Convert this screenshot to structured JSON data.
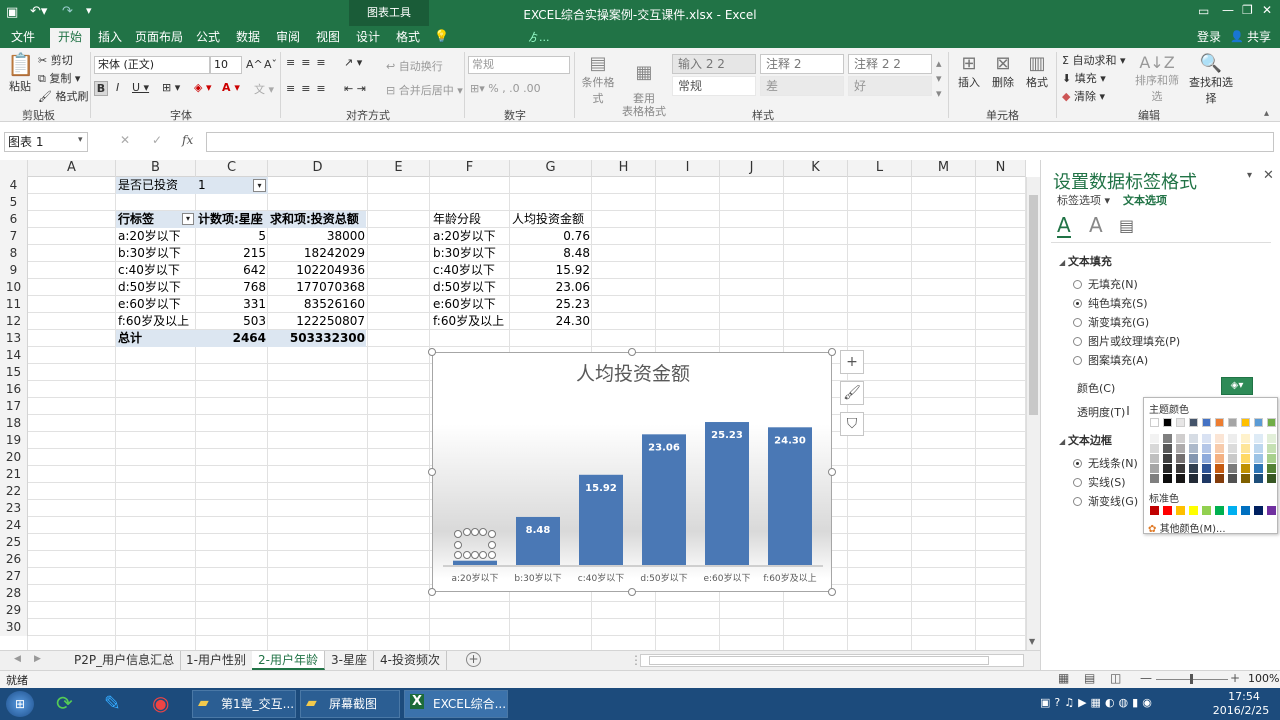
{
  "window": {
    "title": "EXCEL综合实操案例-交互课件.xlsx - Excel",
    "tools_title": "图表工具",
    "signin": "登录",
    "share": "共享"
  },
  "tabs": [
    "文件",
    "开始",
    "插入",
    "页面布局",
    "公式",
    "数据",
    "审阅",
    "视图",
    "设计",
    "格式"
  ],
  "ribbon": {
    "clipboard": {
      "paste": "粘贴",
      "cut": "剪切",
      "copy": "复制",
      "format_painter": "格式刷",
      "label": "剪贴板"
    },
    "font": {
      "name": "宋体 (正文)",
      "size": "10",
      "label": "字体"
    },
    "alignment": {
      "wrap": "自动换行",
      "merge": "合并后居中",
      "label": "对齐方式"
    },
    "number": {
      "format": "常规",
      "label": "数字"
    },
    "styles": {
      "conditional": "条件格式",
      "table": "套用\n表格格式",
      "cells": [
        "输入 2 2",
        "注释 2",
        "注释 2 2",
        "常规",
        "差",
        "好"
      ],
      "label": "样式"
    },
    "cells": {
      "insert": "插入",
      "delete": "删除",
      "format": "格式",
      "label": "单元格"
    },
    "editing": {
      "autosum": "自动求和",
      "fill": "填充",
      "clear": "清除",
      "sort": "排序和筛选",
      "find": "查找和选择",
      "label": "编辑"
    }
  },
  "formula": {
    "namebox": "图表 1",
    "fx": "fx",
    "value": ""
  },
  "columns": [
    "A",
    "B",
    "C",
    "D",
    "E",
    "F",
    "G",
    "H",
    "I",
    "J",
    "K",
    "L",
    "M",
    "N"
  ],
  "rows": [
    "4",
    "5",
    "6",
    "7",
    "8",
    "9",
    "10",
    "11",
    "12",
    "13",
    "14",
    "15",
    "16",
    "17",
    "18",
    "19",
    "20",
    "21",
    "22",
    "23",
    "24",
    "25",
    "26",
    "27",
    "28",
    "29",
    "30"
  ],
  "filter": {
    "label": "是否已投资",
    "value": "1"
  },
  "pivot": {
    "headers": [
      "行标签",
      "计数项:星座",
      "求和项:投资总额"
    ],
    "rows": [
      [
        "a:20岁以下",
        "5",
        "38000"
      ],
      [
        "b:30岁以下",
        "215",
        "18242029"
      ],
      [
        "c:40岁以下",
        "642",
        "102204936"
      ],
      [
        "d:50岁以下",
        "768",
        "177070368"
      ],
      [
        "e:60岁以下",
        "331",
        "83526160"
      ],
      [
        "f:60岁及以上",
        "503",
        "122250807"
      ]
    ],
    "total": [
      "总计",
      "2464",
      "503332300"
    ]
  },
  "table2": {
    "headers": [
      "年龄分段",
      "人均投资金额"
    ],
    "rows": [
      [
        "a:20岁以下",
        "0.76"
      ],
      [
        "b:30岁以下",
        "8.48"
      ],
      [
        "c:40岁以下",
        "15.92"
      ],
      [
        "d:50岁以下",
        "23.06"
      ],
      [
        "e:60岁以下",
        "25.23"
      ],
      [
        "f:60岁及以上",
        "24.30"
      ]
    ]
  },
  "chart_data": {
    "type": "bar",
    "title": "人均投资金额",
    "categories": [
      "a:20岁以下",
      "b:30岁以下",
      "c:40岁以下",
      "d:50岁以下",
      "e:60岁以下",
      "f:60岁及以上"
    ],
    "values": [
      0.76,
      8.48,
      15.92,
      23.06,
      25.23,
      24.3
    ],
    "labels": [
      "",
      "8.48",
      "15.92",
      "23.06",
      "25.23",
      "24.30"
    ],
    "ylim": [
      0,
      30
    ],
    "bar_color": "#4a78b5",
    "legend": "none",
    "grid": false
  },
  "chart_buttons": [
    "+",
    "brush",
    "filter"
  ],
  "sheets": [
    "P2P_用户信息汇总",
    "1-用户性别",
    "2-用户年龄",
    "3-星座",
    "4-投资频次"
  ],
  "status": {
    "ready": "就绪",
    "zoom": "100%"
  },
  "pane": {
    "title": "设置数据标签格式",
    "tab_label_options": "标签选项",
    "tab_text_options": "文本选项",
    "fill_section": "文本填充",
    "fill_options": [
      "无填充(N)",
      "纯色填充(S)",
      "渐变填充(G)",
      "图片或纹理填充(P)",
      "图案填充(A)"
    ],
    "color_label": "颜色(C)",
    "transparency_label": "透明度(T)",
    "border_section": "文本边框",
    "border_options": [
      "无线条(N)",
      "实线(S)",
      "渐变线(G)"
    ]
  },
  "palette": {
    "theme": "主题颜色",
    "standard": "标准色",
    "more": "其他颜色(M)...",
    "standard_colors": [
      "#c00000",
      "#ff0000",
      "#ffc000",
      "#ffff00",
      "#92d050",
      "#00b050",
      "#00b0f0",
      "#0070c0",
      "#002060",
      "#7030a0"
    ]
  },
  "taskbar": {
    "items": [
      "第1章_交互...",
      "屏幕截图",
      "EXCEL综合..."
    ],
    "time": "17:54",
    "date": "2016/2/25"
  }
}
